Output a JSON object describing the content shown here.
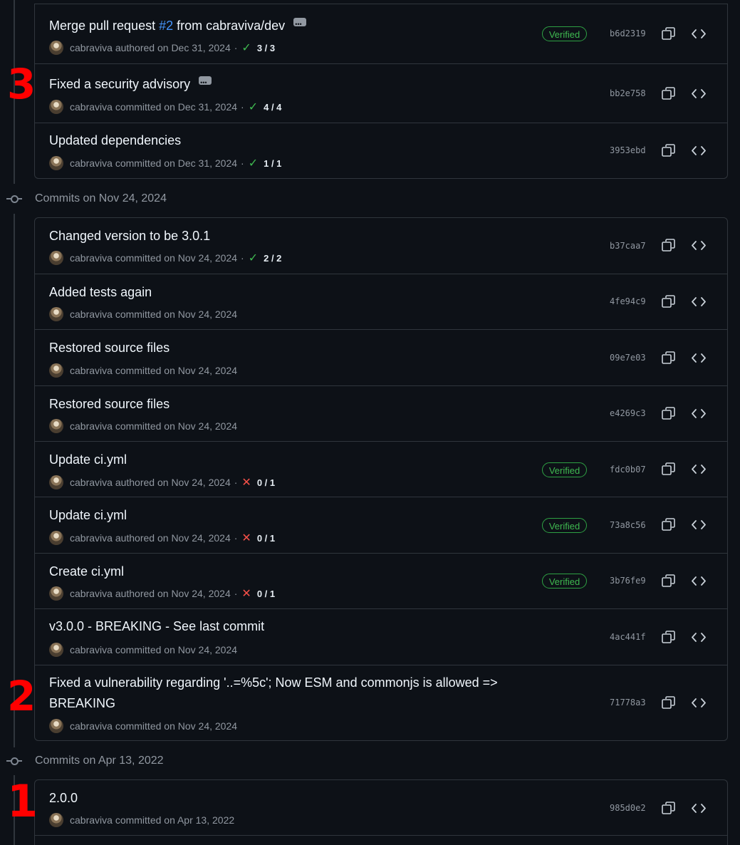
{
  "groups": [
    {
      "date_header": "",
      "commits": [
        {
          "title": "Merge pull request ",
          "pr_link": "#2",
          "title_suffix": " from cabraviva/dev",
          "has_dots": true,
          "author": "cabraviva",
          "action": "authored",
          "date": "on Dec 31, 2024",
          "check": "ok",
          "checks": "3 / 3",
          "verified": "Verified",
          "sha": "b6d2319"
        },
        {
          "title": "Fixed a security advisory",
          "has_dots": true,
          "author": "cabraviva",
          "action": "committed",
          "date": "on Dec 31, 2024",
          "check": "ok",
          "checks": "4 / 4",
          "sha": "bb2e758"
        },
        {
          "title": "Updated dependencies",
          "author": "cabraviva",
          "action": "committed",
          "date": "on Dec 31, 2024",
          "check": "ok",
          "checks": "1 / 1",
          "sha": "3953ebd"
        }
      ]
    },
    {
      "date_header": "Commits on Nov 24, 2024",
      "commits": [
        {
          "title": "Changed version to be 3.0.1",
          "author": "cabraviva",
          "action": "committed",
          "date": "on Nov 24, 2024",
          "check": "ok",
          "checks": "2 / 2",
          "sha": "b37caa7"
        },
        {
          "title": "Added tests again",
          "author": "cabraviva",
          "action": "committed",
          "date": "on Nov 24, 2024",
          "sha": "4fe94c9"
        },
        {
          "title": "Restored source files",
          "author": "cabraviva",
          "action": "committed",
          "date": "on Nov 24, 2024",
          "sha": "09e7e03"
        },
        {
          "title": "Restored source files",
          "author": "cabraviva",
          "action": "committed",
          "date": "on Nov 24, 2024",
          "sha": "e4269c3"
        },
        {
          "title": "Update ci.yml",
          "author": "cabraviva",
          "action": "authored",
          "date": "on Nov 24, 2024",
          "check": "fail",
          "checks": "0 / 1",
          "verified": "Verified",
          "sha": "fdc0b07"
        },
        {
          "title": "Update ci.yml",
          "author": "cabraviva",
          "action": "authored",
          "date": "on Nov 24, 2024",
          "check": "fail",
          "checks": "0 / 1",
          "verified": "Verified",
          "sha": "73a8c56"
        },
        {
          "title": "Create ci.yml",
          "author": "cabraviva",
          "action": "authored",
          "date": "on Nov 24, 2024",
          "check": "fail",
          "checks": "0 / 1",
          "verified": "Verified",
          "sha": "3b76fe9"
        },
        {
          "title": "v3.0.0 - BREAKING - See last commit",
          "author": "cabraviva",
          "action": "committed",
          "date": "on Nov 24, 2024",
          "sha": "4ac441f"
        },
        {
          "title": "Fixed a vulnerability regarding '..=%5c'; Now ESM and commonjs is allowed =>",
          "title_line2": "BREAKING",
          "author": "cabraviva",
          "action": "committed",
          "date": "on Nov 24, 2024",
          "sha": "71778a3"
        }
      ]
    },
    {
      "date_header": "Commits on Apr 13, 2022",
      "commits": [
        {
          "title": "2.0.0",
          "author": "cabraviva",
          "action": "committed",
          "date": "on Apr 13, 2022",
          "sha": "985d0e2"
        }
      ]
    }
  ],
  "annotations": [
    "3",
    "2",
    "1"
  ],
  "colors": {
    "annotation": "#ff0000",
    "verified": "#3fb950",
    "check_ok": "#3fb950",
    "check_fail": "#f85149",
    "link": "#4493f8"
  }
}
